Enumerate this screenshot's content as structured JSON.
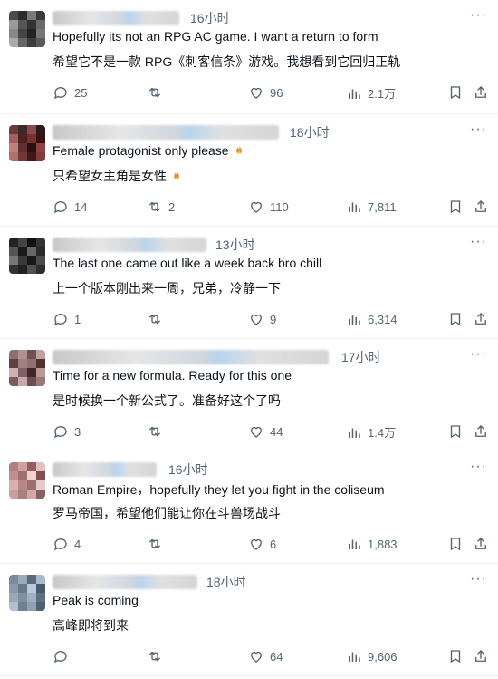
{
  "replies": [
    {
      "time": "16小时",
      "text_en": "Hopefully its not an RPG AC game. I want a return to form",
      "text_zh": "希望它不是一款 RPG《刺客信条》游戏。我想看到它回归正轨",
      "emoji": "",
      "stats": {
        "replies": "25",
        "retweets": "",
        "likes": "96",
        "views": "2.1万"
      }
    },
    {
      "time": "18小时",
      "text_en": "Female protagonist only please",
      "text_zh": "只希望女主角是女性",
      "emoji": "fire-icon",
      "stats": {
        "replies": "14",
        "retweets": "2",
        "likes": "110",
        "views": "7,811"
      }
    },
    {
      "time": "13小时",
      "text_en": "The last one came out like a week back bro chill",
      "text_zh": "上一个版本刚出来一周，兄弟，冷静一下",
      "emoji": "",
      "stats": {
        "replies": "1",
        "retweets": "",
        "likes": "9",
        "views": "6,314"
      }
    },
    {
      "time": "17小时",
      "text_en": "Time for a new formula. Ready for this one",
      "text_zh": "是时候换一个新公式了。准备好这个了吗",
      "emoji": "",
      "stats": {
        "replies": "3",
        "retweets": "",
        "likes": "44",
        "views": "1.4万"
      }
    },
    {
      "time": "16小时",
      "text_en": "Roman Empire，hopefully they let you fight in the coliseum",
      "text_zh": "罗马帝国，希望他们能让你在斗兽场战斗",
      "emoji": "",
      "stats": {
        "replies": "4",
        "retweets": "",
        "likes": "6",
        "views": "1,883"
      }
    },
    {
      "time": "18小时",
      "text_en": "Peak is coming",
      "text_zh": "高峰即将到来",
      "emoji": "",
      "stats": {
        "replies": "",
        "retweets": "",
        "likes": "64",
        "views": "9,606"
      }
    }
  ],
  "colors": {
    "text": "#0f1419",
    "muted": "#536471",
    "fire": "#f28c28"
  }
}
